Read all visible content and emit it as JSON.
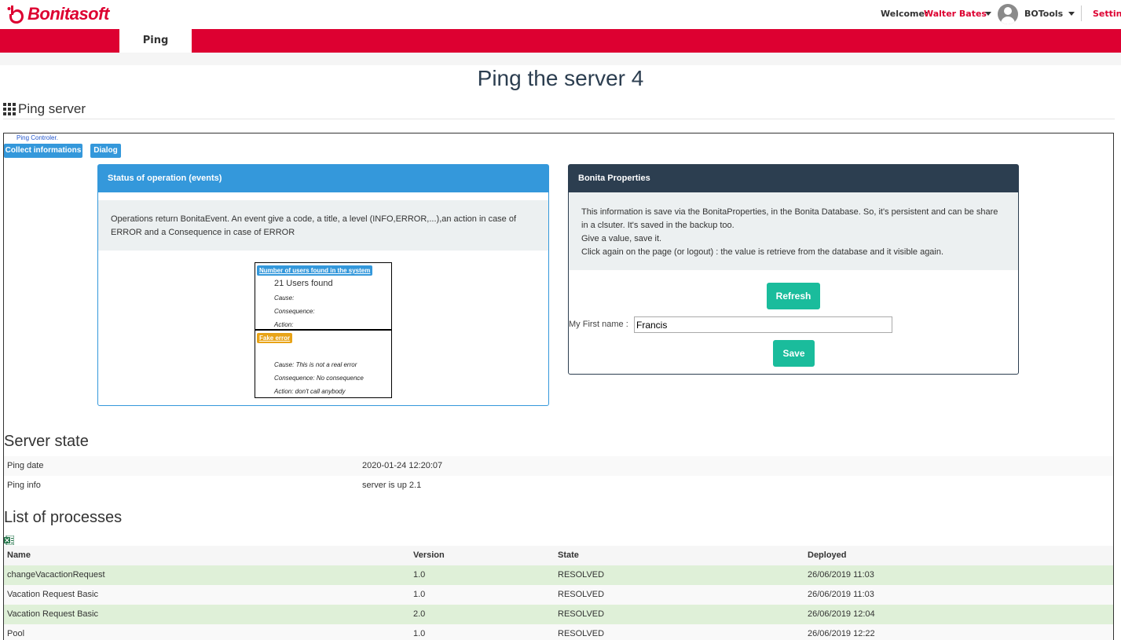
{
  "header": {
    "brand": "Bonitasoft",
    "welcome_label": "Welcome:",
    "user_name": "Walter Bates",
    "app_name": "BOTools",
    "settings_label": "Settings"
  },
  "nav": {
    "active_tab": "Ping"
  },
  "page": {
    "title": "Ping the server 4",
    "section_title": "Ping server",
    "controller_label": "Ping Controler.",
    "collect_button": "Collect informations",
    "dialog_button": "Dialog"
  },
  "status_panel": {
    "title": "Status of operation (events)",
    "description": "Operations return BonitaEvent. An event give a code, a title, a level (INFO,ERROR,...),an action in case of ERROR and a Consequence in case of ERROR",
    "events": [
      {
        "title": "Number of users found in the system",
        "color": "#3498db",
        "main": "21 Users found",
        "cause": "Cause:",
        "consequence": "Consequence:",
        "action": "Action:"
      },
      {
        "title": "Fake error",
        "color": "#e8a317",
        "main": "",
        "cause": "Cause: This is not a real error",
        "consequence": "Consequence: No consequence",
        "action": "Action: don't call anybody"
      }
    ]
  },
  "props_panel": {
    "title": "Bonita Properties",
    "desc_line1": "This information is save via the BonitaProperties, in the Bonita Database. So, it's persistent and can be share in a clsuter. It's saved in the backup too.",
    "desc_line2": "Give a value, save it.",
    "desc_line3": "Click again on the page (or logout) : the value is retrieve from the database and it visible again.",
    "refresh_button": "Refresh",
    "first_name_label": "My First name :",
    "first_name_value": "Francis",
    "save_button": "Save"
  },
  "server_state": {
    "title": "Server state",
    "rows": [
      {
        "key": "Ping date",
        "value": "2020-01-24 12:20:07"
      },
      {
        "key": "Ping info",
        "value": "server is up 2.1"
      }
    ]
  },
  "processes": {
    "title": "List of processes",
    "columns": [
      "Name",
      "Version",
      "State",
      "Deployed"
    ],
    "rows": [
      {
        "name": "changeVacactionRequest",
        "version": "1.0",
        "state": "RESOLVED",
        "deployed": "26/06/2019 11:03"
      },
      {
        "name": "Vacation Request Basic",
        "version": "1.0",
        "state": "RESOLVED",
        "deployed": "26/06/2019 11:03"
      },
      {
        "name": "Vacation Request Basic",
        "version": "2.0",
        "state": "RESOLVED",
        "deployed": "26/06/2019 12:04"
      },
      {
        "name": "Pool",
        "version": "1.0",
        "state": "RESOLVED",
        "deployed": "26/06/2019 12:22"
      }
    ]
  },
  "colors": {
    "brand_red": "#dd0031",
    "primary_blue": "#3498db",
    "dark_panel": "#2c3e50",
    "success_green": "#1abc9c",
    "row_green": "#dff0d8"
  }
}
